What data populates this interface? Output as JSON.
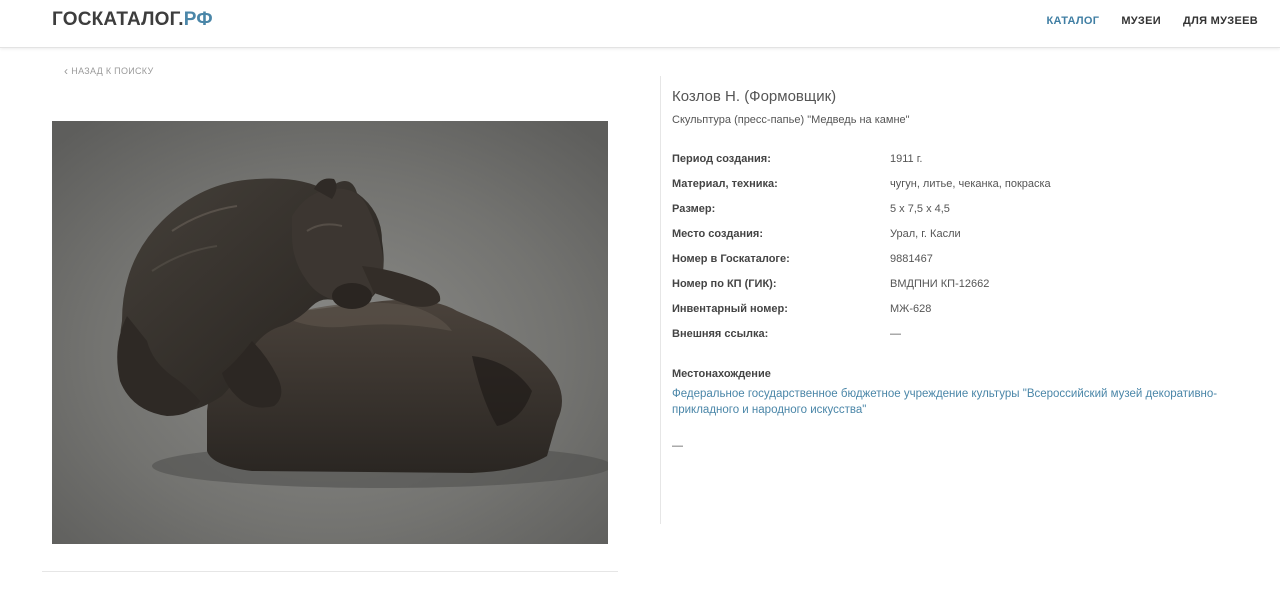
{
  "header": {
    "logo_main": "ГОСКАТАЛОГ.",
    "logo_tld": "РФ",
    "nav": [
      "КАТАЛОГ",
      "МУЗЕИ",
      "ДЛЯ МУЗЕЕВ"
    ]
  },
  "back_link": "НАЗАД К ПОИСКУ",
  "item": {
    "author": "Козлов Н. (Формовщик)",
    "title": "Скульптура (пресс-папье) \"Медведь на камне\"",
    "properties": [
      {
        "label": "Период создания:",
        "value": "1911 г."
      },
      {
        "label": "Материал, техника:",
        "value": "чугун, литье, чеканка, покраска"
      },
      {
        "label": "Размер:",
        "value": "5 х 7,5 х 4,5"
      },
      {
        "label": "Место создания:",
        "value": "Урал, г. Касли"
      },
      {
        "label": "Номер в Госкаталоге:",
        "value": "9881467"
      },
      {
        "label": "Номер по КП (ГИК):",
        "value": "ВМДПНИ КП-12662"
      },
      {
        "label": "Инвентарный номер:",
        "value": "МЖ-628"
      },
      {
        "label": "Внешняя ссылка:",
        "value": "—"
      }
    ],
    "location_heading": "Местонахождение",
    "location_value": "Федеральное государственное бюджетное учреждение культуры \"Всероссийский музей декоративно-прикладного и народного искусства\"",
    "footer_dash": "—"
  },
  "colors": {
    "accent": "#4a86a8",
    "nav_active": "#3f7ea3",
    "text": "#444444"
  }
}
